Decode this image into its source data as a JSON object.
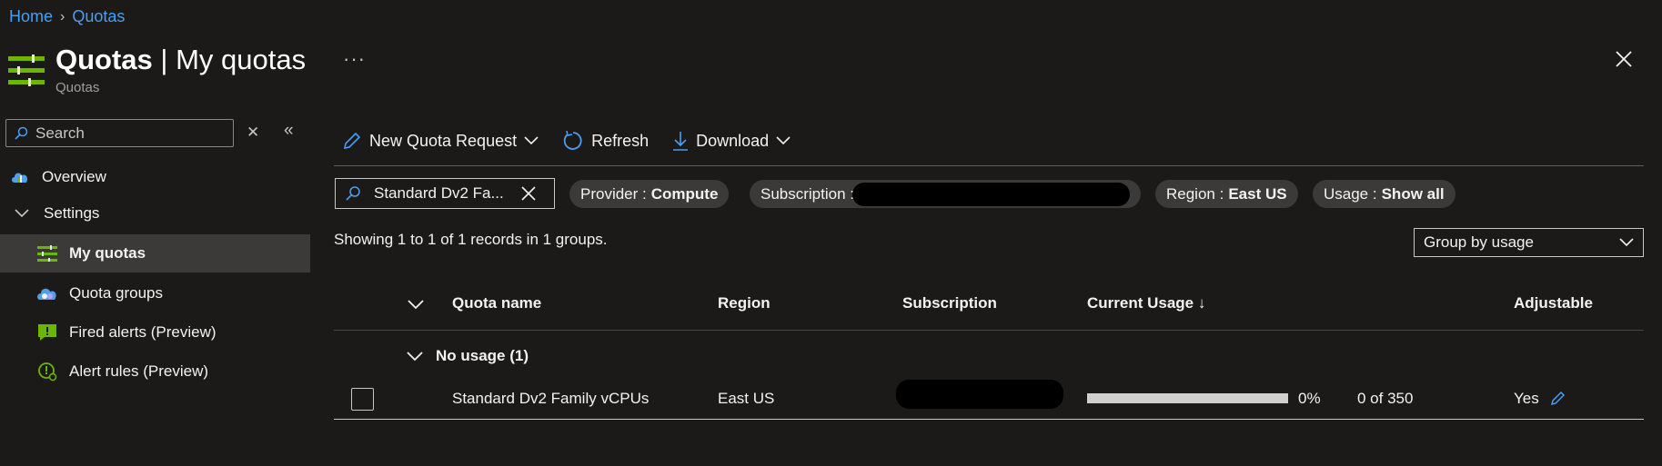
{
  "breadcrumb": {
    "home": "Home",
    "current": "Quotas"
  },
  "header": {
    "title_bold": "Quotas",
    "title_rest": " | My quotas",
    "subtitle": "Quotas",
    "more_label": "···"
  },
  "sidebar": {
    "search_placeholder": "Search",
    "items": [
      {
        "label": "Overview"
      },
      {
        "label": "Settings"
      },
      {
        "label": "My quotas"
      },
      {
        "label": "Quota groups"
      },
      {
        "label": "Fired alerts (Preview)"
      },
      {
        "label": "Alert rules (Preview)"
      }
    ]
  },
  "toolbar": {
    "new_request": "New Quota Request",
    "refresh": "Refresh",
    "download": "Download"
  },
  "filters": {
    "search_value": "Standard Dv2 Fa...",
    "provider_label": "Provider :",
    "provider_value": "Compute",
    "subscription_label": "Subscription :",
    "region_label": "Region :",
    "region_value": "East US",
    "usage_label": "Usage :",
    "usage_value": "Show all"
  },
  "records_text": "Showing 1 to 1 of 1 records in 1 groups.",
  "group_by": {
    "selected": "Group by usage"
  },
  "table": {
    "columns": {
      "quota_name": "Quota name",
      "region": "Region",
      "subscription": "Subscription",
      "current_usage": "Current Usage ↓",
      "adjustable": "Adjustable"
    },
    "group": {
      "label": "No usage (1)"
    },
    "rows": [
      {
        "quota_name": "Standard Dv2 Family vCPUs",
        "region": "East US",
        "usage_percent_text": "0%",
        "usage_percent": 0,
        "usage_count": "0 of 350",
        "adjustable": "Yes"
      }
    ]
  },
  "colors": {
    "accent": "#479ef5",
    "background": "#1b1a19",
    "icon_green": "#6bb700"
  }
}
